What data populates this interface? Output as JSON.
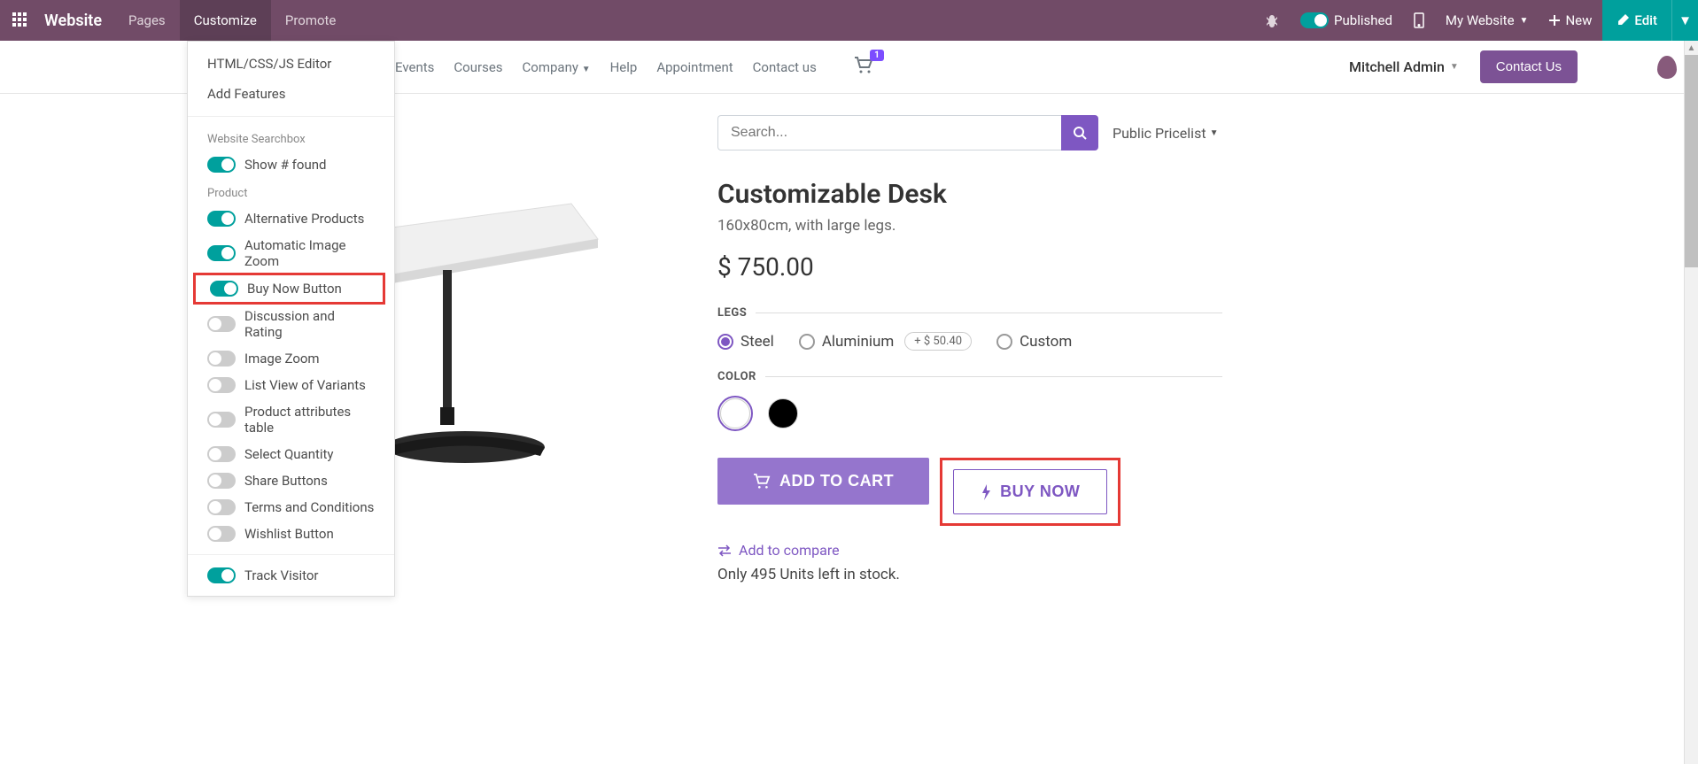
{
  "topbar": {
    "brand": "Website",
    "menu": [
      "Pages",
      "Customize",
      "Promote"
    ],
    "published": "Published",
    "my_website": "My Website",
    "new": "New",
    "edit": "Edit"
  },
  "dropdown": {
    "html_editor": "HTML/CSS/JS Editor",
    "add_features": "Add Features",
    "section1": "Website Searchbox",
    "show_found": "Show # found",
    "section2": "Product",
    "options": [
      {
        "label": "Alternative Products",
        "on": true
      },
      {
        "label": "Automatic Image Zoom",
        "on": true
      },
      {
        "label": "Buy Now Button",
        "on": true,
        "highlight": true
      },
      {
        "label": "Discussion and Rating",
        "on": false
      },
      {
        "label": "Image Zoom",
        "on": false
      },
      {
        "label": "List View of Variants",
        "on": false
      },
      {
        "label": "Product attributes table",
        "on": false
      },
      {
        "label": "Select Quantity",
        "on": false
      },
      {
        "label": "Share Buttons",
        "on": false
      },
      {
        "label": "Terms and Conditions",
        "on": false
      },
      {
        "label": "Wishlist Button",
        "on": false
      }
    ],
    "track_visitor": "Track Visitor"
  },
  "nav2": {
    "items": [
      "Events",
      "Courses",
      "Company",
      "Help",
      "Appointment",
      "Contact us"
    ],
    "cart_count": "1",
    "user": "Mitchell Admin",
    "contact": "Contact Us"
  },
  "search": {
    "placeholder": "Search...",
    "pricelist": "Public Pricelist"
  },
  "product": {
    "title": "Customizable Desk",
    "subtitle": "160x80cm, with large legs.",
    "price": "$ 750.00",
    "legs_label": "LEGS",
    "legs": [
      {
        "name": "Steel",
        "selected": true
      },
      {
        "name": "Aluminium",
        "selected": false,
        "extra": "+ $ 50.40"
      },
      {
        "name": "Custom",
        "selected": false
      }
    ],
    "color_label": "COLOR",
    "colors": [
      {
        "name": "white",
        "hex": "#ffffff",
        "selected": true
      },
      {
        "name": "black",
        "hex": "#000000",
        "selected": false
      }
    ],
    "add_to_cart": "ADD TO CART",
    "buy_now": "BUY NOW",
    "compare": "Add to compare",
    "stock": "Only 495 Units left in stock."
  }
}
